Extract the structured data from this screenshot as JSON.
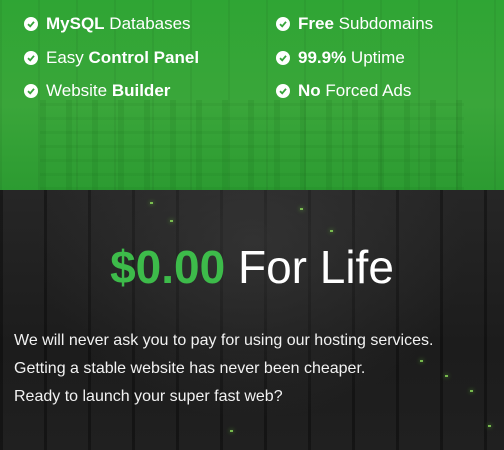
{
  "features": {
    "items": [
      {
        "bold": "MySQL",
        "text": " Databases"
      },
      {
        "pre": "Easy ",
        "bold": "Control Panel"
      },
      {
        "pre": "Website ",
        "bold": "Builder"
      },
      {
        "bold": "Free",
        "text": " Subdomains"
      },
      {
        "bold": "99.9%",
        "text": " Uptime"
      },
      {
        "bold": "No",
        "text": " Forced Ads"
      }
    ]
  },
  "hero": {
    "price": "$0.00",
    "suffix": " For Life",
    "lines": [
      "We will never ask you to pay for using our hosting services.",
      "Getting a stable website has never been cheaper.",
      "Ready to launch your super fast web?"
    ]
  },
  "colors": {
    "features_bg": "#36a33a",
    "price": "#3dbb4a",
    "hero_bg": "#1e1e1e"
  },
  "icons": {
    "feature_bullet": "check-circle-icon"
  }
}
